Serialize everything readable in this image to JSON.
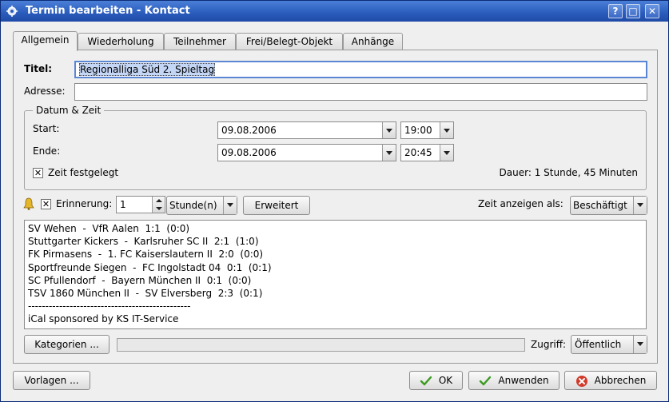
{
  "window": {
    "title": "Termin bearbeiten - Kontact",
    "icon": "kontact-gear-icon"
  },
  "titlebar_buttons": {
    "help": "?",
    "maximize": "□",
    "close": "✕"
  },
  "tabs": [
    {
      "label": "Allgemein",
      "active": true
    },
    {
      "label": "Wiederholung",
      "active": false
    },
    {
      "label": "Teilnehmer",
      "active": false
    },
    {
      "label": "Frei/Belegt-Objekt",
      "active": false
    },
    {
      "label": "Anhänge",
      "active": false
    }
  ],
  "general": {
    "title_label": "Titel:",
    "title_value": "Regionalliga Süd 2. Spieltag",
    "address_label": "Adresse:",
    "address_value": ""
  },
  "datetime": {
    "group_label": "Datum & Zeit",
    "start_label": "Start:",
    "start_date": "09.08.2006",
    "start_time": "19:00",
    "end_label": "Ende:",
    "end_date": "09.08.2006",
    "end_time": "20:45",
    "fixed_time_label": "Zeit festgelegt",
    "fixed_time_checked": true,
    "duration": "Dauer: 1 Stunde, 45 Minuten"
  },
  "reminder": {
    "label": "Erinnerung:",
    "checked": true,
    "value": "1",
    "unit": "Stunde(n)",
    "advanced_button": "Erweitert",
    "show_as_label": "Zeit anzeigen als:",
    "show_as_value": "Beschäftigt"
  },
  "description_lines": [
    "SV Wehen  -  VfR Aalen  1:1  (0:0)",
    "Stuttgarter Kickers  -  Karlsruher SC II  2:1  (1:0)",
    "FK Pirmasens  -  1. FC Kaiserslautern II  2:0  (0:0)",
    "Sportfreunde Siegen  -  FC Ingolstadt 04  0:1  (0:1)",
    "SC Pfullendorf  -  Bayern München II  0:1  (0:0)",
    "TSV 1860 München II  -  SV Elversberg  2:3  (0:1)",
    "-----------------------------------------------",
    "iCal sponsored by KS IT-Service"
  ],
  "bottom_panel": {
    "categories_button": "Kategorien ...",
    "access_label": "Zugriff:",
    "access_value": "Öffentlich"
  },
  "dialog_buttons": {
    "templates": "Vorlagen ...",
    "ok": "OK",
    "apply": "Anwenden",
    "cancel": "Abbrechen"
  },
  "colors": {
    "titlebar": "#2a5cbc",
    "selection": "#c4d6f5",
    "ok_check": "#3a9a1f",
    "cancel_red": "#d23a2a"
  }
}
